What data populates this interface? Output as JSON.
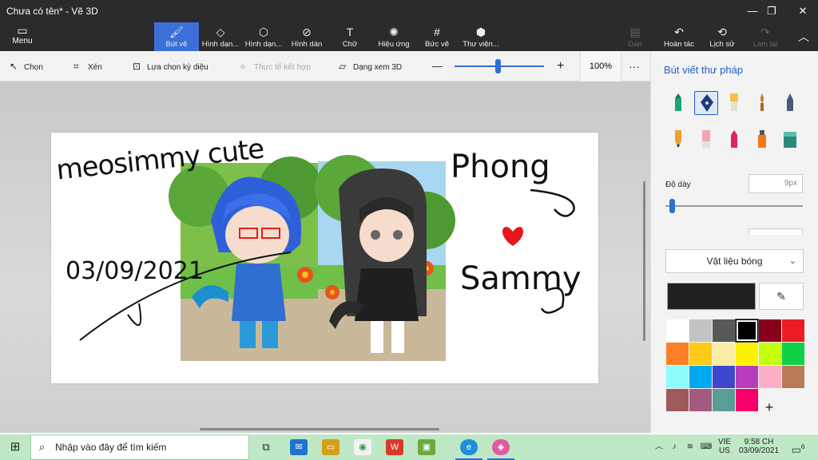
{
  "window": {
    "title": "Chưa có tên* - Vẽ 3D",
    "min": "—",
    "max": "❐",
    "close": "✕"
  },
  "ribbon": {
    "menu": "Menu",
    "tabs": [
      {
        "label": "Bút vẽ",
        "icon": "brush-icon",
        "glyph": "🖌"
      },
      {
        "label": "Hình dạn...",
        "icon": "2d-shapes-icon",
        "glyph": "◇"
      },
      {
        "label": "Hình dạn...",
        "icon": "3d-shapes-icon",
        "glyph": "⬡"
      },
      {
        "label": "Hình dán",
        "icon": "stickers-icon",
        "glyph": "⊘"
      },
      {
        "label": "Chữ",
        "icon": "text-icon",
        "glyph": "T"
      },
      {
        "label": "Hiệu ứng",
        "icon": "effects-icon",
        "glyph": "✺"
      },
      {
        "label": "Bức vẽ",
        "icon": "canvas-icon",
        "glyph": "#"
      },
      {
        "label": "Thư viện...",
        "icon": "library-icon",
        "glyph": "⬢"
      }
    ],
    "actions": [
      {
        "label": "Dán",
        "icon": "paste-icon",
        "glyph": "📋"
      },
      {
        "label": "Hoàn tác",
        "icon": "undo-icon",
        "glyph": "↶"
      },
      {
        "label": "Lịch sử",
        "icon": "history-icon",
        "glyph": "⟲"
      },
      {
        "label": "Làm lại",
        "icon": "redo-icon",
        "glyph": "↷"
      }
    ],
    "collapse": "︿"
  },
  "toolbar": {
    "select": "Chọn",
    "crop": "Xén",
    "magic_select": "Lựa chọn kỳ diệu",
    "mixed_reality": "Thực tế kết hợp",
    "view_3d": "Dạng xem 3D",
    "zoom_out": "—",
    "zoom_in": "+",
    "zoom_value": "100%",
    "zoom_fraction": 0.48,
    "more": "···"
  },
  "canvas": {
    "text_top": "meosimmy cute",
    "date": "03/09/2021",
    "name1": "Phong",
    "name2": "Sammy"
  },
  "panel": {
    "title": "Bút viết thư pháp",
    "thickness_label": "Độ dày",
    "thickness_value": "9px",
    "thickness_fraction": 0.03,
    "material": "Vật liệu bóng",
    "material_chevron": "⌄",
    "eyedropper": "✎",
    "add_color": "+",
    "colors": [
      "#ffffff",
      "#c3c3c3",
      "#585858",
      "#000000",
      "#88001b",
      "#ec1c24",
      "#ff7f27",
      "#ffca18",
      "#fdeca6",
      "#fff200",
      "#c4ff0e",
      "#0ed145",
      "#8cfffb",
      "#00a8f3",
      "#3f48cc",
      "#b83dba",
      "#ffaec8",
      "#b97a56",
      "#9c5a5a",
      "#a35a7f",
      "#5a9c96",
      "#f5006b"
    ],
    "selected_color": "#000000"
  },
  "taskbar": {
    "search_placeholder": "Nhập vào đây để tìm kiếm",
    "lang_top": "VIE",
    "lang_bottom": "US",
    "time": "9:58 CH",
    "date": "03/09/2021",
    "notification_count": "6"
  }
}
